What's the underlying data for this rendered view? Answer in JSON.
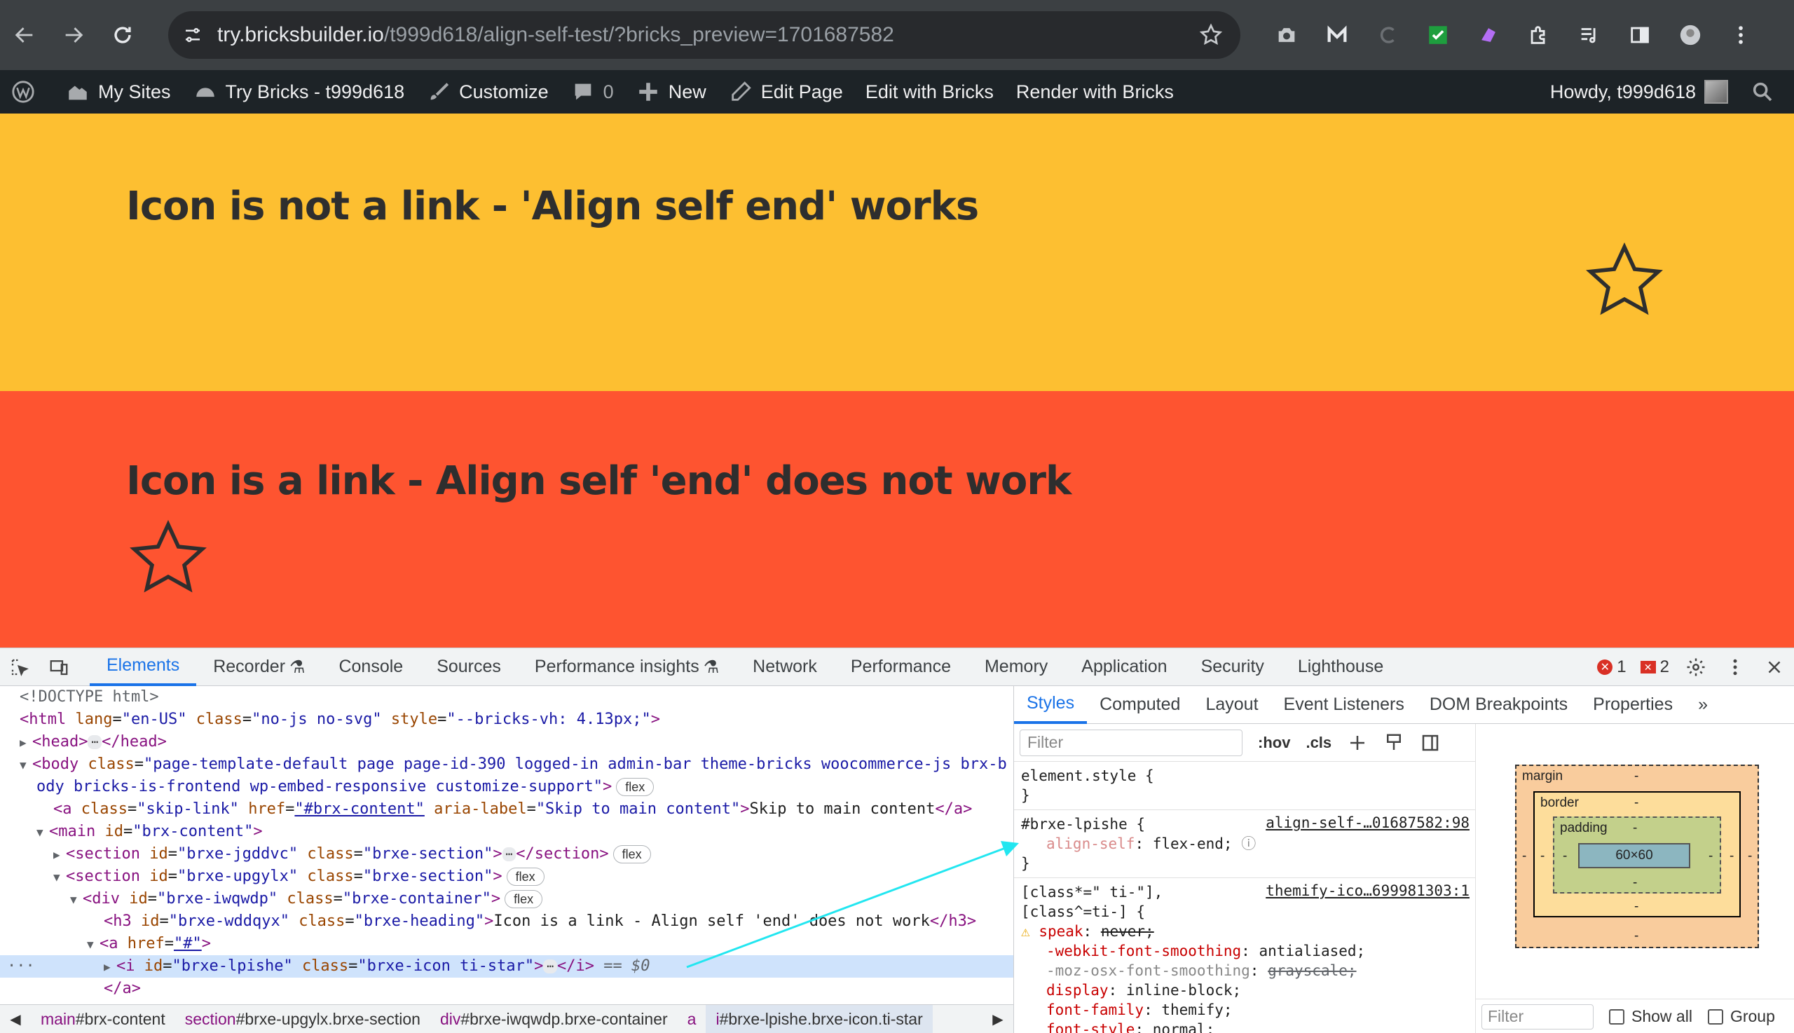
{
  "browser": {
    "url_host": "try.bricksbuilder.io",
    "url_path": "/t999d618/align-self-test/?bricks_preview=1701687582"
  },
  "admin_bar": {
    "my_sites": "My Sites",
    "site_name": "Try Bricks - t999d618",
    "customize": "Customize",
    "comments_count": "0",
    "new": "New",
    "edit_page": "Edit Page",
    "edit_with_bricks": "Edit with Bricks",
    "render_with_bricks": "Render with Bricks",
    "howdy": "Howdy, t999d618"
  },
  "page": {
    "section1_heading": "Icon is not a link - 'Align self end' works",
    "section2_heading": "Icon is a link - Align self 'end' does not work",
    "section1_color": "#fdbf31",
    "section2_color": "#fe5430"
  },
  "devtools": {
    "tabs": [
      "Elements",
      "Recorder",
      "Console",
      "Sources",
      "Performance insights",
      "Network",
      "Performance",
      "Memory",
      "Application",
      "Security",
      "Lighthouse"
    ],
    "error_count": "1",
    "issue_count": "2",
    "dom": {
      "doctype": "<!DOCTYPE html>",
      "html_attrs": [
        "lang",
        "\"en-US\"",
        "class",
        "\"no-js no-svg\"",
        "style",
        "\"--bricks-vh: 4.13px;\""
      ],
      "body_class_1": "\"page-template-default page page-id-390 logged-in admin-bar theme-bricks woocommerce-js brx-b",
      "body_class_2": "ody bricks-is-frontend wp-embed-responsive customize-support\"",
      "skip_href": "\"#brx-content\"",
      "skip_label": "\"Skip to main content\"",
      "skip_text": "Skip to main content",
      "main_id": "\"brx-content\"",
      "sec1_id": "\"brxe-jgddvc\"",
      "sec2_id": "\"brxe-upgylx\"",
      "sec_class": "\"brxe-section\"",
      "div_id": "\"brxe-iwqwdp\"",
      "div_class": "\"brxe-container\"",
      "h3_id": "\"brxe-wddqyx\"",
      "h3_class": "\"brxe-heading\"",
      "h3_text": "Icon is a link - Align self 'end' does not work",
      "a_href": "\"#\"",
      "i_id": "\"brxe-lpishe\"",
      "i_class": "\"brxe-icon ti-star\"",
      "eq": "== $0",
      "flex": "flex"
    },
    "breadcrumbs": [
      {
        "tag": "main",
        "rest": "#brx-content"
      },
      {
        "tag": "section",
        "rest": "#brxe-upgylx.brxe-section"
      },
      {
        "tag": "div",
        "rest": "#brxe-iwqwdp.brxe-container"
      },
      {
        "tag": "a",
        "rest": ""
      },
      {
        "tag": "i",
        "rest": "#brxe-lpishe.brxe-icon.ti-star"
      }
    ],
    "styles_tabs": [
      "Styles",
      "Computed",
      "Layout",
      "Event Listeners",
      "DOM Breakpoints",
      "Properties"
    ],
    "filter_placeholder": "Filter",
    "hov": ":hov",
    "cls": ".cls",
    "rules": {
      "element_style": "element.style {",
      "rule1_selector": "#brxe-lpishe {",
      "rule1_source": "align-self-…01687582:98",
      "rule1_prop": "align-self",
      "rule1_value": "flex-end;",
      "rule2_selector": "[class*=\" ti-\"],",
      "rule2_selector_b": "[class^=ti-] {",
      "rule2_source": "themify-ico…699981303:1",
      "decls": [
        {
          "prop": "speak",
          "value": "never;"
        },
        {
          "prop": "-webkit-font-smoothing",
          "value": "antialiased;"
        },
        {
          "prop": "-moz-osx-font-smoothing",
          "value": "grayscale;"
        },
        {
          "prop": "display",
          "value": "inline-block;"
        },
        {
          "prop": "font-family",
          "value": "themify;"
        },
        {
          "prop": "font-style",
          "value": "normal;"
        }
      ]
    },
    "box_model": {
      "margin_label": "margin",
      "border_label": "border",
      "padding_label": "padding",
      "content_size": "60×60",
      "dash": "-"
    },
    "computed_filter": {
      "placeholder": "Filter",
      "show_all": "Show all",
      "group": "Group"
    }
  }
}
